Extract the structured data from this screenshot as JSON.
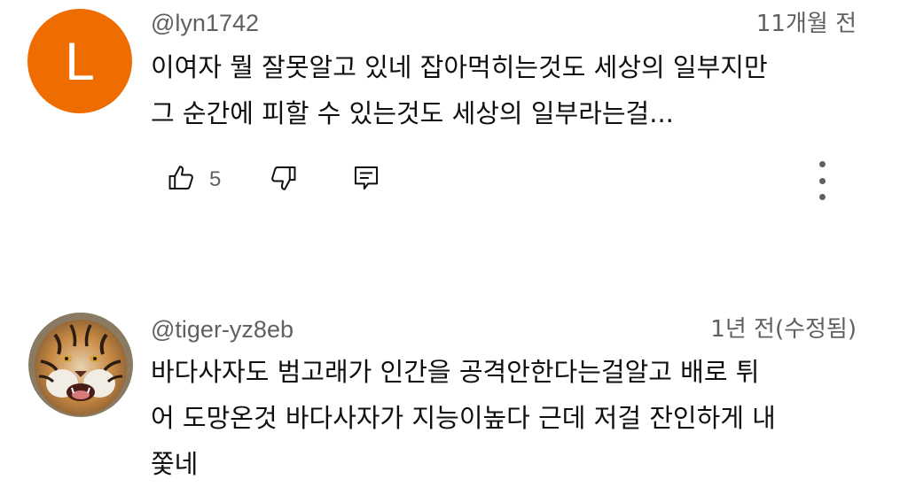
{
  "comments": [
    {
      "avatar_letter": "L",
      "avatar_color": "#ef6c00",
      "author": "@lyn1742",
      "timestamp": "11개월 전",
      "text": "이여자 뭘 잘못알고 있네 잡아먹히는것도 세상의 일부지만\n그 순간에 피할 수 있는것도 세상의 일부라는걸...",
      "like_count": "5"
    },
    {
      "avatar_icon": "tiger-avatar",
      "author": "@tiger-yz8eb",
      "timestamp": "1년 전(수정됨)",
      "text": "바다사자도 범고래가 인간을 공격안한다는걸알고 배로 튀\n어 도망온것 바다사자가 지능이높다 근데 저걸 잔인하게 내\n쫓네"
    }
  ],
  "icons": {
    "like": "thumbs-up-icon",
    "dislike": "thumbs-down-icon",
    "reply": "reply-icon",
    "more": "more-vert-icon"
  },
  "colors": {
    "secondary_text": "#606060",
    "primary_text": "#0f0f0f"
  }
}
